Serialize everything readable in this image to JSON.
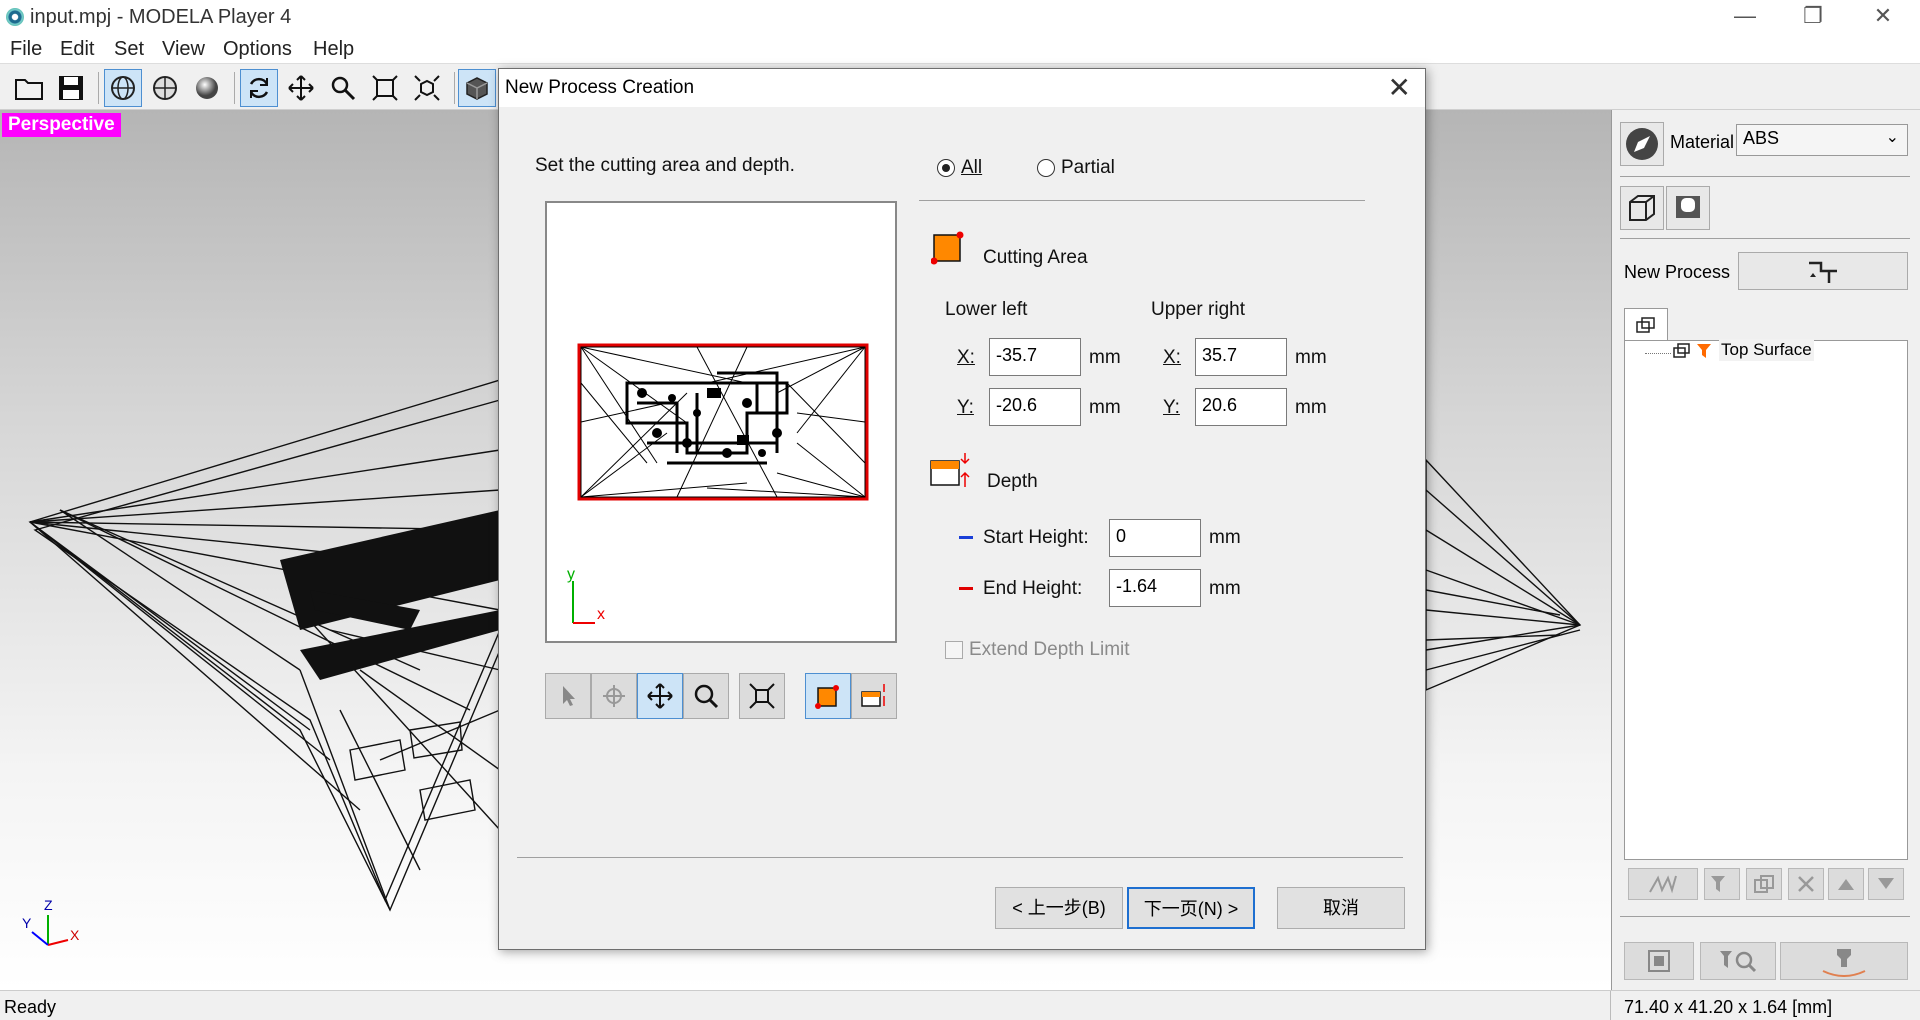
{
  "window": {
    "title": "input.mpj - MODELA Player 4"
  },
  "menu": [
    {
      "label": "File"
    },
    {
      "label": "Edit"
    },
    {
      "label": "Set"
    },
    {
      "label": "View"
    },
    {
      "label": "Options"
    },
    {
      "label": "Help"
    }
  ],
  "viewport": {
    "view_label": "Perspective",
    "axis": {
      "y": "Y",
      "z": "Z",
      "x": "X"
    }
  },
  "right_panel": {
    "material_label": "Material",
    "material_value": "ABS",
    "new_process_label": "New Process",
    "tree_item": "Top Surface"
  },
  "status": {
    "left": "Ready",
    "right": "71.40 x 41.20 x 1.64 [mm]"
  },
  "dialog": {
    "title": "New Process Creation",
    "instruction": "Set the cutting area and depth.",
    "radio_all": "All",
    "radio_partial": "Partial",
    "cutting_area": "Cutting Area",
    "lower_left": "Lower left",
    "upper_right": "Upper right",
    "x_label": "X:",
    "y_label": "Y:",
    "unit": "mm",
    "ll_x": "-35.7",
    "ll_y": "-20.6",
    "ur_x": "35.7",
    "ur_y": "20.6",
    "depth": "Depth",
    "start_height_label": "Start Height:",
    "start_height": "0",
    "end_height_label": "End Height:",
    "end_height": "-1.64",
    "extend_depth": "Extend Depth Limit",
    "preview_axis": {
      "y": "y",
      "x": "x"
    },
    "btn_back": "< 上一步(B)",
    "btn_next": "下一页(N) >",
    "btn_cancel": "取消"
  },
  "colors": {
    "accent": "#ff00ff",
    "selection_red": "#e00000",
    "orange": "#ff8800",
    "primary_border": "#1e6fd0"
  }
}
